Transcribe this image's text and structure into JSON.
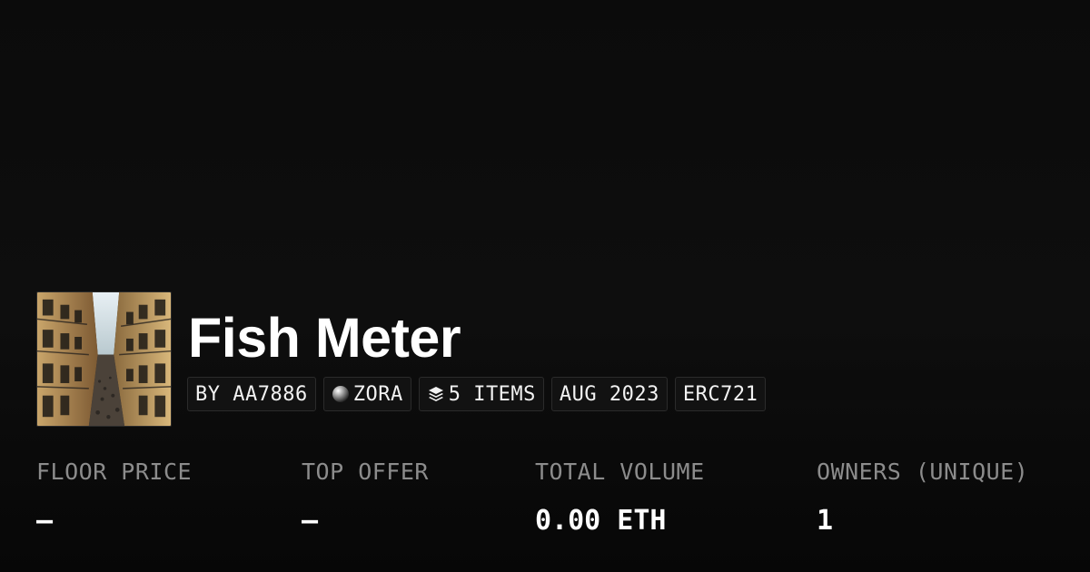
{
  "collection": {
    "title": "Fish Meter",
    "thumbnail_icon": "street-photo-thumbnail"
  },
  "tags": [
    {
      "label": "BY AA7886",
      "icon": null
    },
    {
      "label": "ZORA",
      "icon": "zora-orb-icon"
    },
    {
      "label": "5 ITEMS",
      "icon": "layers-icon"
    },
    {
      "label": "AUG 2023",
      "icon": null
    },
    {
      "label": "ERC721",
      "icon": null
    }
  ],
  "stats": [
    {
      "label": "FLOOR PRICE",
      "value": "–"
    },
    {
      "label": "TOP OFFER",
      "value": "–"
    },
    {
      "label": "TOTAL VOLUME",
      "value": "0.00 ETH"
    },
    {
      "label": "OWNERS (UNIQUE)",
      "value": "1"
    }
  ],
  "colors": {
    "background": "#0b0b0b",
    "text": "#ffffff",
    "muted": "#8c8c8c",
    "tag_bg": "#121212",
    "tag_border": "#2b2b2b"
  }
}
